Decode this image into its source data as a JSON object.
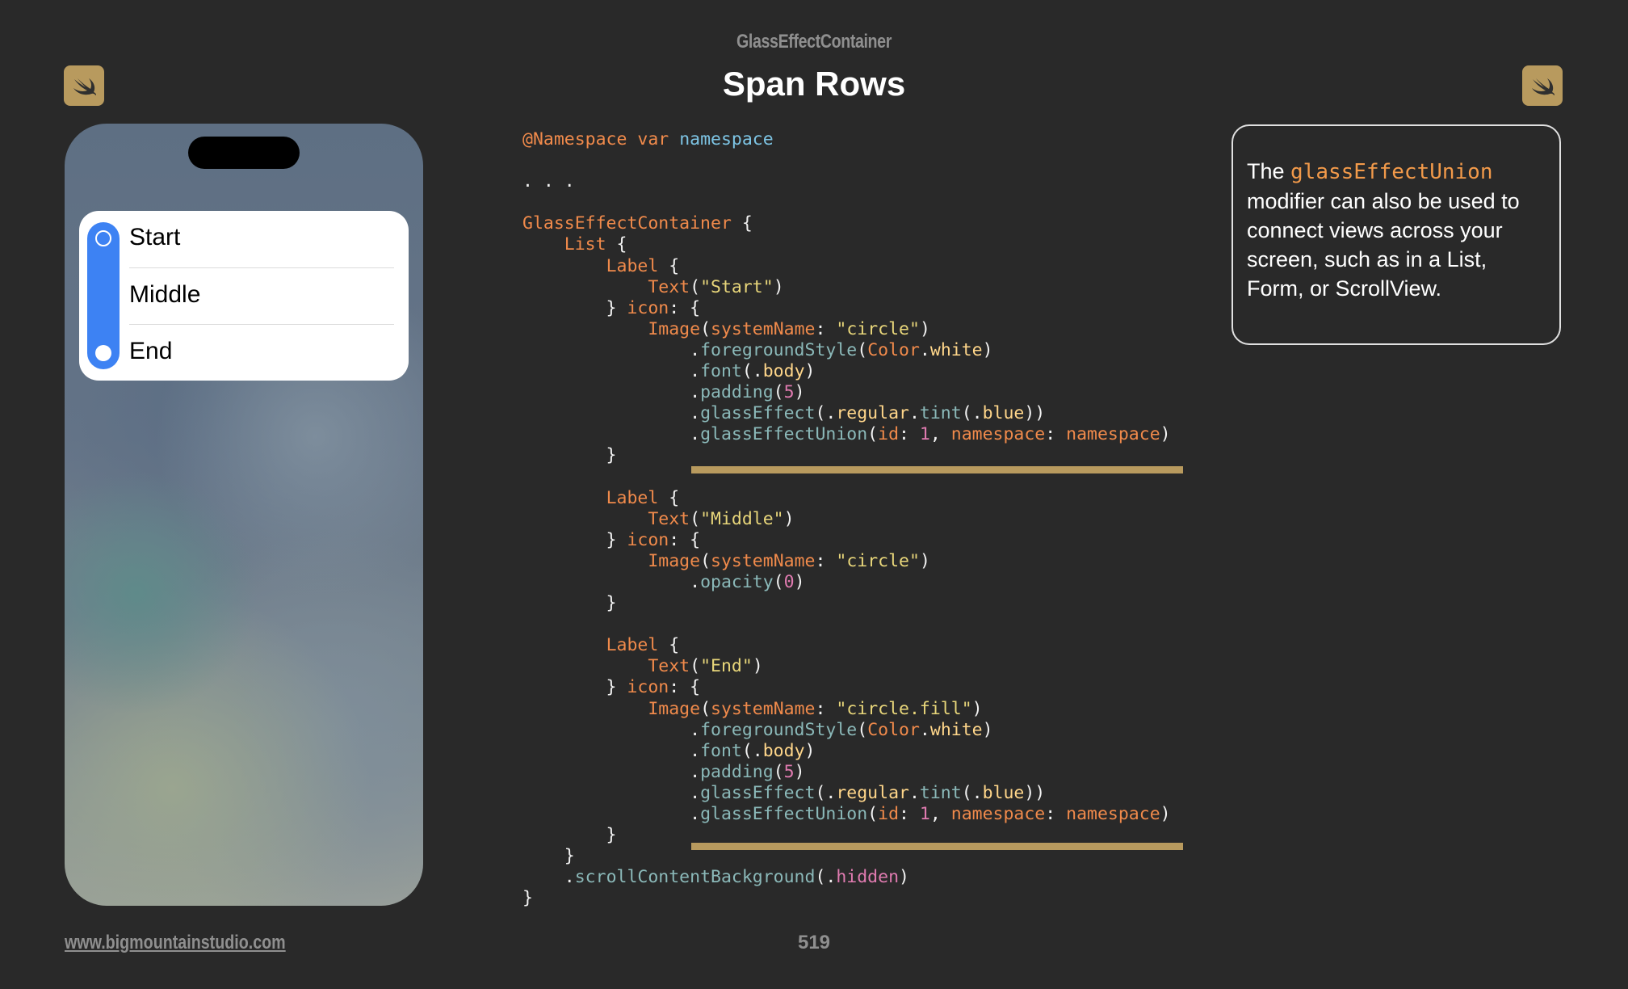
{
  "header": {
    "section": "GlassEffectContainer",
    "title": "Span Rows"
  },
  "phone": {
    "rows": [
      {
        "label": "Start",
        "icon": "circle-icon"
      },
      {
        "label": "Middle",
        "icon": "circle-icon"
      },
      {
        "label": "End",
        "icon": "circle-fill-icon"
      }
    ],
    "tint_color": "#3d82f3"
  },
  "code": {
    "lines": [
      "@Namespace var namespace",
      "",
      ". . .",
      "",
      "GlassEffectContainer {",
      "    List {",
      "        Label {",
      "            Text(\"Start\")",
      "        } icon: {",
      "            Image(systemName: \"circle\")",
      "                .foregroundStyle(Color.white)",
      "                .font(.body)",
      "                .padding(5)",
      "                .glassEffect(.regular.tint(.blue))",
      "                .glassEffectUnion(id: 1, namespace: namespace)",
      "        }",
      "",
      "        Label {",
      "            Text(\"Middle\")",
      "        } icon: {",
      "            Image(systemName: \"circle\")",
      "                .opacity(0)",
      "        }",
      "",
      "        Label {",
      "            Text(\"End\")",
      "        } icon: {",
      "            Image(systemName: \"circle.fill\")",
      "                .foregroundStyle(Color.white)",
      "                .font(.body)",
      "                .padding(5)",
      "                .glassEffect(.regular.tint(.blue))",
      "                .glassEffectUnion(id: 1, namespace: namespace)",
      "        }",
      "    }",
      "    .scrollContentBackground(.hidden)",
      "}"
    ],
    "highlight_color": "#b89a5e"
  },
  "note": {
    "prefix": "The ",
    "code_term": "glassEffectUnion",
    "suffix": " modifier can also be used to connect views across your screen, such as in a List, Form, or ScrollView."
  },
  "footer": {
    "url": "www.bigmountainstudio.com",
    "page": "519"
  },
  "icons": [
    "swift-logo-icon",
    "circle-icon",
    "circle-fill-icon"
  ],
  "colors": {
    "background": "#292929",
    "accent": "#b89a5e",
    "keyword": "#f08a4b",
    "string": "#e8d67a"
  }
}
